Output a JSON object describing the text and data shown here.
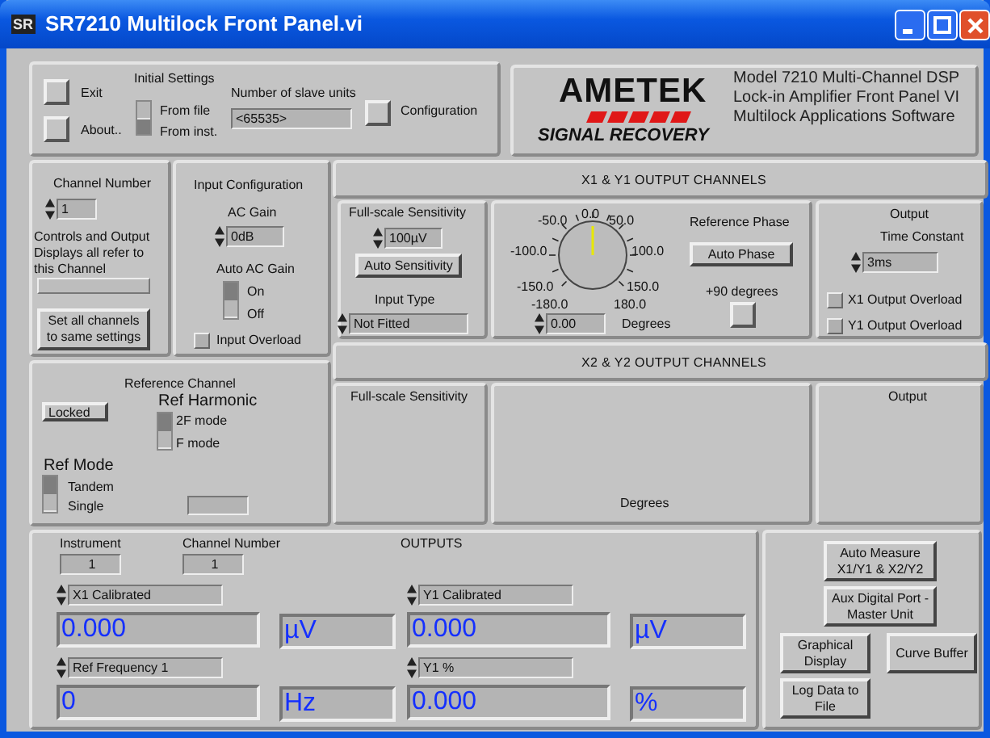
{
  "window": {
    "badge": "SR",
    "title": "SR7210 Multilock Front Panel.vi"
  },
  "top": {
    "exit": "Exit",
    "about": "About..",
    "initial_settings": {
      "label": "Initial Settings",
      "options": [
        {
          "label": "From file",
          "selected": false
        },
        {
          "label": "From inst.",
          "selected": true
        }
      ]
    },
    "slave_units": {
      "label": "Number of slave units",
      "value": "<65535>"
    },
    "configuration": "Configuration"
  },
  "logo": {
    "brand": "AMETEK",
    "tagline": "SIGNAL RECOVERY",
    "lines": [
      "Model 7210 Multi-Channel DSP",
      "Lock-in Amplifier Front Panel VI",
      "Multilock Applications Software"
    ]
  },
  "channel": {
    "label": "Channel Number",
    "value": "1",
    "note": "Controls and Output Displays all refer to this Channel",
    "set_all": "Set all channels to same settings"
  },
  "input_config": {
    "title": "Input Configuration",
    "ac_gain_label": "AC Gain",
    "ac_gain": "0dB",
    "auto_label": "Auto AC Gain",
    "auto_options": [
      {
        "label": "On",
        "selected": true
      },
      {
        "label": "Off",
        "selected": false
      }
    ],
    "overload": {
      "label": "Input Overload",
      "checked": false
    }
  },
  "x1y1": {
    "header": "X1 & Y1 OUTPUT CHANNELS",
    "sens_label": "Full-scale Sensitivity",
    "sens": "100µV",
    "auto_sens": "Auto Sensitivity",
    "input_type_label": "Input Type",
    "input_type": "Not Fitted",
    "dial": {
      "labels": [
        "-50.0",
        "0.0",
        "50.0",
        "-100.0",
        "100.0",
        "-150.0",
        "150.0",
        "-180.0",
        "180.0"
      ],
      "value": "0.00",
      "unit": "Degrees"
    },
    "ref_phase_label": "Reference Phase",
    "auto_phase": "Auto Phase",
    "plus90_label": "+90 degrees",
    "output_label": "Output",
    "tc_label": "Time Constant",
    "tc": "3ms",
    "overloads": [
      {
        "label": "X1 Output Overload",
        "checked": false
      },
      {
        "label": "Y1 Output Overload",
        "checked": false
      }
    ]
  },
  "x2y2": {
    "header": "X2 & Y2 OUTPUT CHANNELS",
    "sens_label": "Full-scale Sensitivity",
    "unit": "Degrees",
    "output_label": "Output"
  },
  "reference": {
    "title": "Reference Channel",
    "locked": "Locked",
    "harmonic_label": "Ref Harmonic",
    "harmonic": [
      {
        "label": "2F mode",
        "selected": true
      },
      {
        "label": "F mode",
        "selected": false
      }
    ],
    "mode_label": "Ref Mode",
    "mode": [
      {
        "label": "Tandem",
        "selected": true
      },
      {
        "label": "Single",
        "selected": false
      }
    ]
  },
  "outputs": {
    "instrument_label": "Instrument",
    "instrument": "1",
    "channel_label": "Channel Number",
    "channel": "1",
    "title": "OUTPUTS",
    "readouts": [
      {
        "selector": "X1 Calibrated",
        "value": "0.000",
        "unit": "µV"
      },
      {
        "selector": "Y1 Calibrated",
        "value": "0.000",
        "unit": "µV"
      },
      {
        "selector": "Ref Frequency 1",
        "value": "0",
        "unit": "Hz"
      },
      {
        "selector": "Y1 %",
        "value": "0.000",
        "unit": "%"
      }
    ]
  },
  "actions": [
    "Auto Measure X1/Y1 & X2/Y2",
    "Aux Digital Port - Master Unit",
    "Graphical Display",
    "Curve Buffer",
    "Log Data to File"
  ]
}
